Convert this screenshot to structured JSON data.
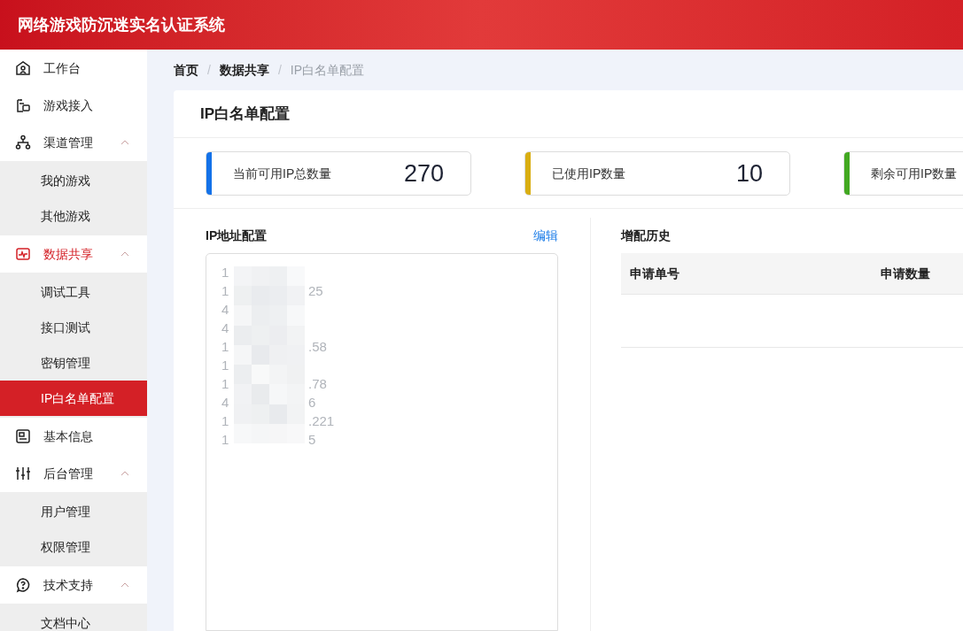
{
  "header": {
    "title": "网络游戏防沉迷实名认证系统"
  },
  "sidebar": {
    "items": [
      {
        "label": "工作台",
        "selected": false
      },
      {
        "label": "游戏接入",
        "selected": false
      },
      {
        "label": "渠道管理",
        "selected": false,
        "expanded": true,
        "children": [
          {
            "label": "我的游戏",
            "selected": false
          },
          {
            "label": "其他游戏",
            "selected": false
          }
        ]
      },
      {
        "label": "数据共享",
        "selected": true,
        "expanded": true,
        "children": [
          {
            "label": "调试工具",
            "selected": false
          },
          {
            "label": "接口测试",
            "selected": false
          },
          {
            "label": "密钥管理",
            "selected": false
          },
          {
            "label": "IP白名单配置",
            "selected": true
          }
        ]
      },
      {
        "label": "基本信息",
        "selected": false
      },
      {
        "label": "后台管理",
        "selected": false,
        "expanded": true,
        "children": [
          {
            "label": "用户管理",
            "selected": false
          },
          {
            "label": "权限管理",
            "selected": false
          }
        ]
      },
      {
        "label": "技术支持",
        "selected": false,
        "expanded": true,
        "children": [
          {
            "label": "文档中心",
            "selected": false
          }
        ]
      }
    ]
  },
  "breadcrumb": {
    "separator": "/",
    "items": [
      "首页",
      "数据共享",
      "IP白名单配置"
    ]
  },
  "page_title": "IP白名单配置",
  "stats": [
    {
      "label": "当前可用IP总数量",
      "value": "270",
      "color": "#1472e8"
    },
    {
      "label": "已使用IP数量",
      "value": "10",
      "color": "#d9ae12"
    },
    {
      "label": "剩余可用IP数量",
      "color": "#42a822"
    }
  ],
  "ip_config": {
    "title": "IP地址配置",
    "edit_link": "编辑",
    "lines": [
      {
        "start": "1"
      },
      {
        "start": "1",
        "end": "25"
      },
      {
        "start": "4"
      },
      {
        "start": "4"
      },
      {
        "start": "1",
        "end": ".58"
      },
      {
        "start": "1"
      },
      {
        "start": "1",
        "end": ".78"
      },
      {
        "start": "4",
        "end": "6"
      },
      {
        "start": "1",
        "end": ".221"
      },
      {
        "start": "1",
        "end": "5"
      }
    ]
  },
  "history": {
    "title": "增配历史",
    "columns": [
      "申请单号",
      "申请数量"
    ]
  }
}
